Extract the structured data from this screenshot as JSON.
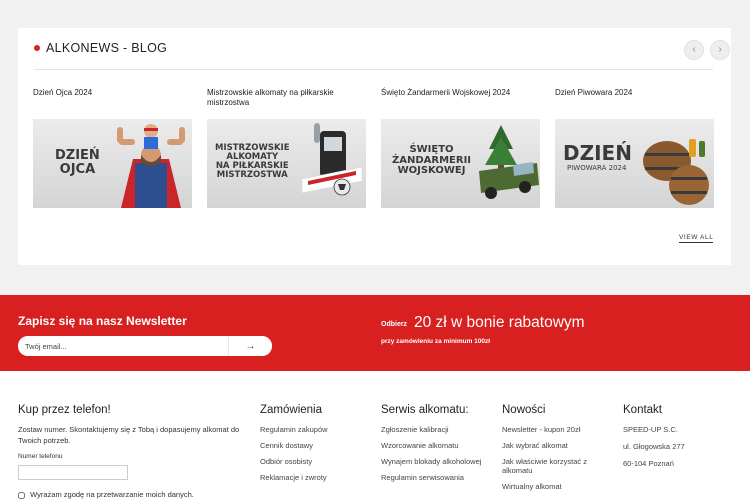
{
  "blog": {
    "title": "ALKONEWS - BLOG",
    "prev_icon": "chevron-left-icon",
    "next_icon": "chevron-right-icon",
    "view_all": "VIEW ALL",
    "posts": [
      {
        "title": "Dzień Ojca 2024",
        "image_text": "DZIEŃ\nOJCA"
      },
      {
        "title": "Mistrzowskie alkomaty na piłkarskie mistrzostwa",
        "image_text": "MISTRZOWSKIE\nALKOMATY\nNA PIŁKARSKIE\nMISTRZOSTWA"
      },
      {
        "title": "Święto Żandarmerii Wojskowej 2024",
        "image_text": "ŚWIĘTO\nŻANDARMERII\nWOJSKOWEJ"
      },
      {
        "title": "Dzień Piwowara 2024",
        "image_text_big": "DZIEŃ",
        "image_text_small": "PIWOWARA 2024"
      }
    ]
  },
  "newsletter": {
    "title": "Zapisz się na nasz Newsletter",
    "email_placeholder": "Twój email...",
    "submit_icon": "arrow-right-icon",
    "submit_label": "→",
    "promo_prefix": "Odbierz",
    "promo_main": "20 zł w bonie rabatowym",
    "promo_sub": "przy zamówieniu za minimum 100zł",
    "accent_color": "#d7201f"
  },
  "footer": {
    "phone": {
      "title": "Kup przez telefon!",
      "description": "Zostaw numer. Skontaktujemy się z Tobą i dopasujemy alkomat do Twoich potrzeb.",
      "field_label": "Numer telefonu",
      "consent": "Wyrażam zgodę na przetwarzanie moich danych."
    },
    "orders": {
      "title": "Zamówienia",
      "links": [
        "Regulamin zakupów",
        "Cennik dostawy",
        "Odbiór osobisty",
        "Reklamacje i zwroty"
      ]
    },
    "service": {
      "title": "Serwis alkomatu:",
      "links": [
        "Zgłoszenie kalibracji",
        "Wzorcowanie alkomatu",
        "Wynajem blokady alkoholowej",
        "Regulamin serwisowania"
      ]
    },
    "news": {
      "title": "Nowości",
      "links": [
        "Newsletter - kupon 20zł",
        "Jak wybrać alkomat",
        "Jak właściwie korzystać z alkomatu",
        "Wirtualny alkomat"
      ]
    },
    "contact": {
      "title": "Kontakt",
      "lines": [
        "SPEED-UP S.C.",
        "ul. Głogowska 277",
        "60-104 Poznań"
      ]
    }
  }
}
